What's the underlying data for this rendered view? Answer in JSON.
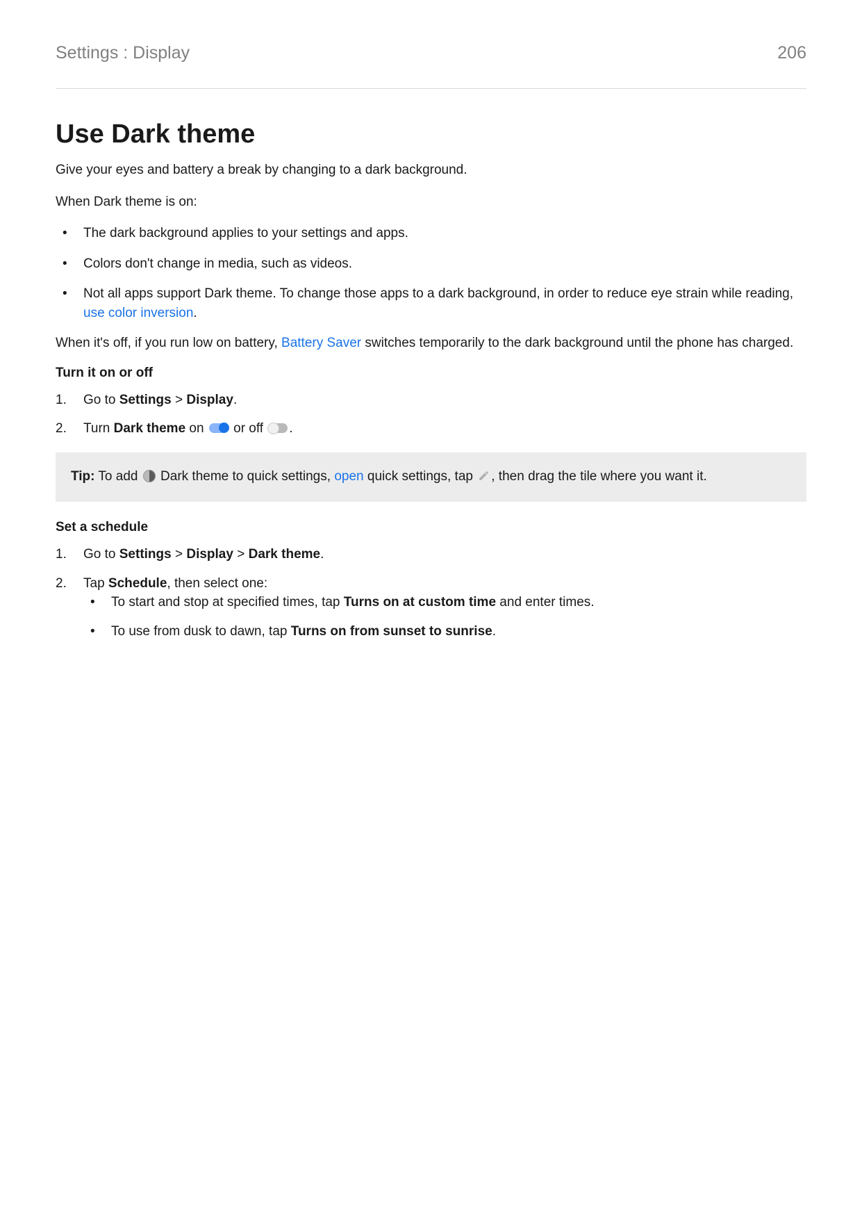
{
  "header": {
    "breadcrumb": "Settings : Display",
    "page_number": "206"
  },
  "title": "Use Dark theme",
  "intro_para": "Give your eyes and battery a break by changing to a dark background.",
  "when_on": "When Dark theme is on:",
  "bullets": [
    "The dark background applies to your settings and apps.",
    "Colors don't change in media, such as videos."
  ],
  "bullet3_a": "Not all apps support Dark theme. To change those apps to a dark background, in order to reduce eye strain while reading, ",
  "bullet3_link": "use color inversion",
  "bullet3_b": ".",
  "when_off_a": "When it's off, if you run low on battery, ",
  "when_off_link": "Battery Saver",
  "when_off_b": " switches temporarily to the dark background until the phone has charged.",
  "turn_head": "Turn it on or off",
  "steps_turn": {
    "s1_a": "Go to ",
    "s1_settings": "Settings",
    "s1_gt": " > ",
    "s1_display": "Display",
    "s1_dot": ".",
    "s2_a": "Turn ",
    "s2_dark": "Dark theme",
    "s2_on": " on ",
    "s2_or_off": " or off ",
    "s2_dot": "."
  },
  "tip": {
    "label": "Tip:",
    "a": " To add ",
    "b": " Dark theme to quick settings, ",
    "open": "open",
    "c": " quick settings, tap ",
    "d": ", then drag the tile where you want it."
  },
  "schedule_head": "Set a schedule",
  "steps_sched": {
    "s1_a": "Go to ",
    "s1_settings": "Settings",
    "s1_gt1": " > ",
    "s1_display": "Display",
    "s1_gt2": " > ",
    "s1_dark": "Dark theme",
    "s1_dot": ".",
    "s2_a": "Tap ",
    "s2_schedule": "Schedule",
    "s2_b": ", then select one:",
    "b1_a": "To start and stop at specified times, tap ",
    "b1_bold": "Turns on at custom time",
    "b1_b": " and enter times.",
    "b2_a": "To use from dusk to dawn, tap ",
    "b2_bold": "Turns on from sunset to sunrise",
    "b2_b": "."
  }
}
